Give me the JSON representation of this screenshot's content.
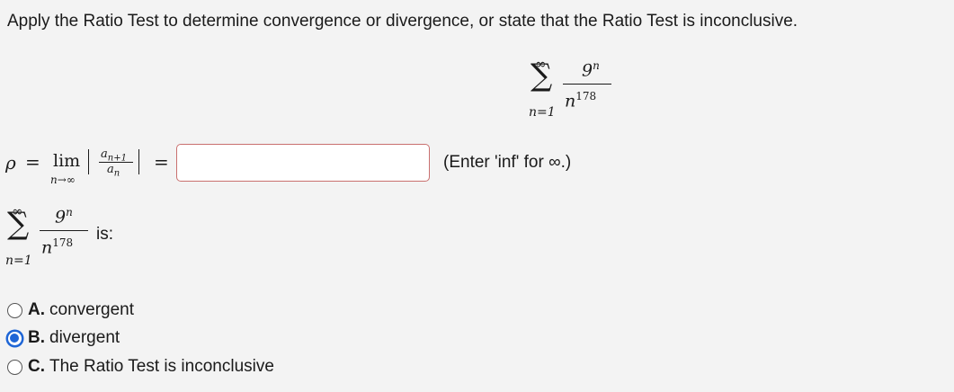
{
  "question": "Apply the Ratio Test to determine convergence or divergence, or state that the Ratio Test is inconclusive.",
  "series": {
    "sum_symbol": "∑",
    "upper_limit": "∞",
    "lower_limit": "n=1",
    "numerator_base": "9",
    "numerator_exp": "n",
    "denominator_base": "n",
    "denominator_exp": "178"
  },
  "ratio": {
    "rho": "ρ",
    "equals": "=",
    "lim": "lim",
    "lim_sub": "n→∞",
    "a_next_base": "a",
    "a_next_sub": "n+1",
    "a_base": "a",
    "a_sub": "n",
    "answer_value": "",
    "hint": "(Enter 'inf' for ∞.)"
  },
  "prompt_suffix": "is:",
  "options": [
    {
      "letter": "A.",
      "text": "convergent",
      "selected": false
    },
    {
      "letter": "B.",
      "text": "divergent",
      "selected": true
    },
    {
      "letter": "C.",
      "text": "The Ratio Test is inconclusive",
      "selected": false
    }
  ],
  "colors": {
    "background": "#f3f3f3",
    "input_border": "#c9706f",
    "radio_selected": "#1f66d6"
  }
}
